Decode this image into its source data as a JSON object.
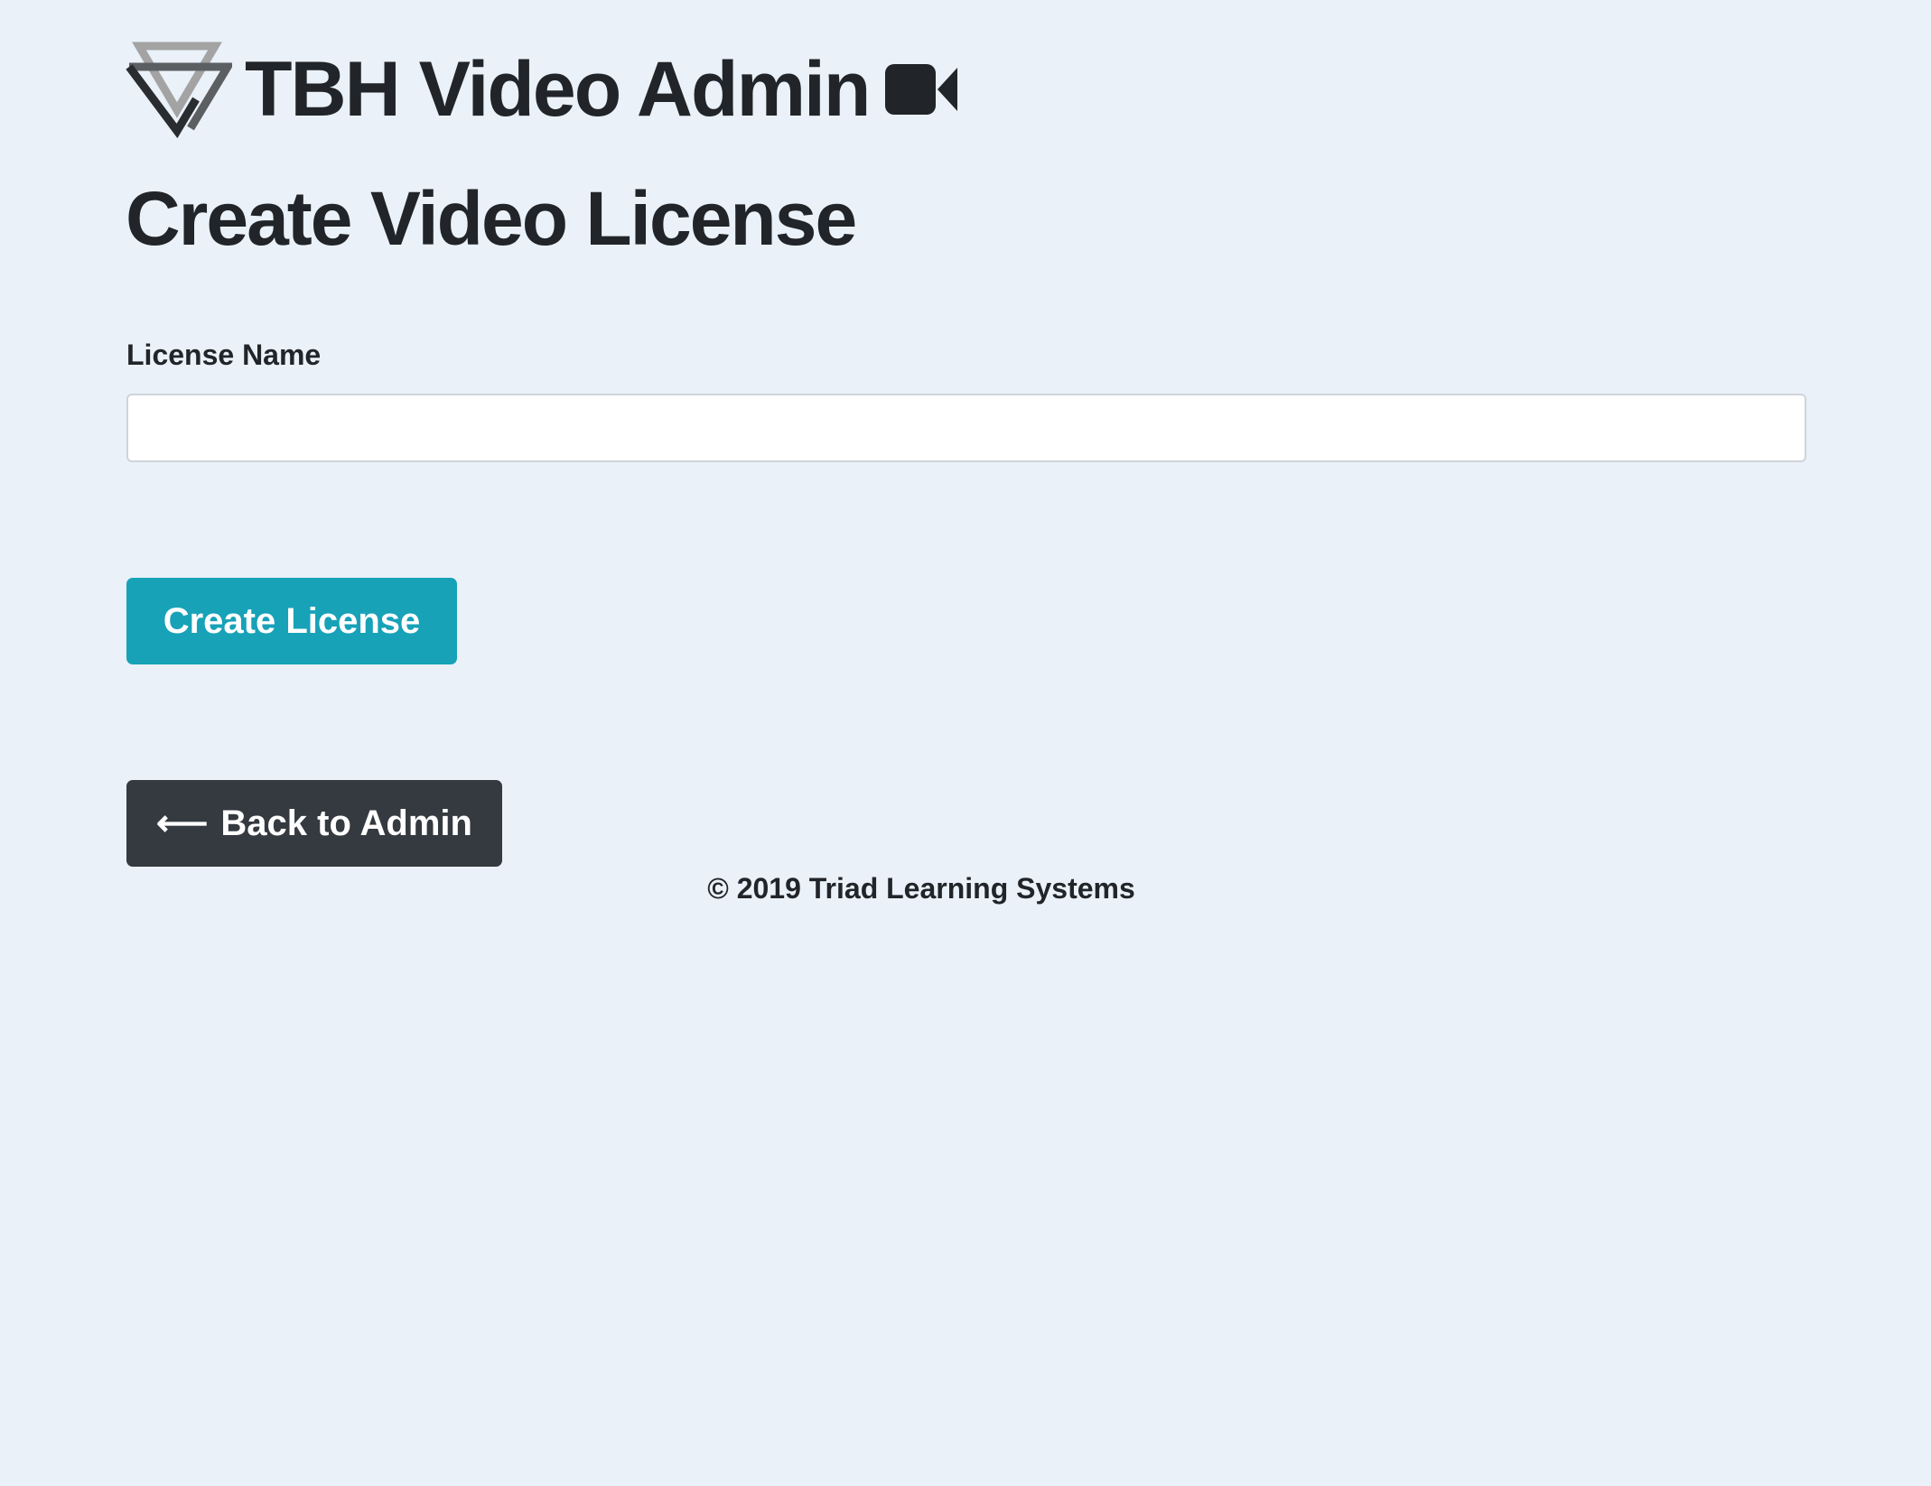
{
  "header": {
    "logo_icon": "triad-logo-icon",
    "title": "TBH Video Admin",
    "title_icon": "video-camera-icon"
  },
  "page": {
    "title": "Create Video License"
  },
  "form": {
    "license_name_label": "License Name",
    "license_name_value": "",
    "license_name_placeholder": "",
    "submit_label": "Create License"
  },
  "navigation": {
    "back_arrow": "⟵",
    "back_label": "Back to Admin",
    "back_icon": "left-arrow-icon"
  },
  "footer": {
    "copyright": "© 2019 Triad Learning Systems"
  },
  "colors": {
    "background": "#eaf1f8",
    "primary_button": "#17a2b8",
    "dark_button": "#343a40",
    "text": "#212529"
  }
}
